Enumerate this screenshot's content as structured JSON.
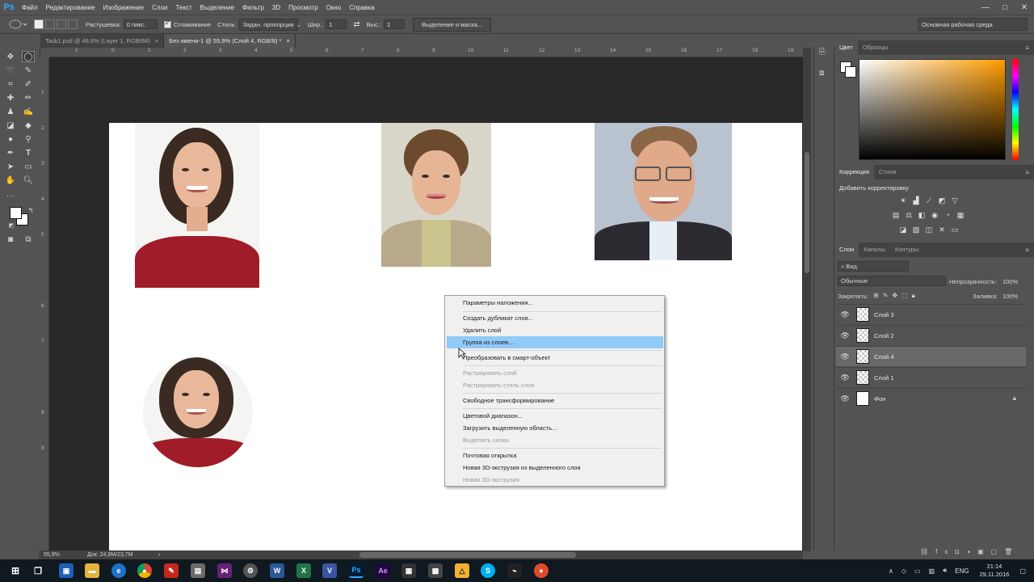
{
  "app": {
    "logo": "Ps"
  },
  "menubar": {
    "items": [
      "Файл",
      "Редактирование",
      "Изображение",
      "Слои",
      "Текст",
      "Выделение",
      "Фильтр",
      "3D",
      "Просмотр",
      "Окно",
      "Справка"
    ],
    "window_controls": [
      "—",
      "□",
      "✕"
    ]
  },
  "options": {
    "feather_label": "Растушевка:",
    "feather_value": "0 пикс.",
    "antialias_label": "Сглаживание",
    "style_label": "Стиль:",
    "style_value": "Задан. пропорции",
    "width_label": "Шир.:",
    "width_value": "1",
    "height_label": "Выс.:",
    "height_value": "1",
    "mask_button": "Выделение и маска...",
    "workspace": "Основная рабочая среда"
  },
  "tabs": [
    {
      "label": "Task1.psd @ 48,8% (Layer 1, RGB/8#)",
      "active": false
    },
    {
      "label": "Без имени-1 @ 55,9% (Слой 4, RGB/8) *",
      "active": true
    }
  ],
  "ruler": {
    "top": [
      "1",
      "0",
      "1",
      "2",
      "3",
      "4",
      "5",
      "6",
      "7",
      "8",
      "9",
      "10",
      "11",
      "12",
      "13",
      "14",
      "15",
      "16",
      "17",
      "18",
      "19"
    ],
    "left": [
      "1",
      "2",
      "3",
      "4",
      "5",
      "6",
      "7",
      "8",
      "9"
    ]
  },
  "statusbar": {
    "zoom": "55,9%",
    "doc": "Док: 24,9M/23,7M"
  },
  "panels": {
    "color_tabs": [
      "Цвет",
      "Образцы"
    ],
    "adjust_tabs": [
      "Коррекция",
      "Стили"
    ],
    "adjust_title": "Добавить корректировку",
    "layers_tabs": [
      "Слои",
      "Каналы",
      "Контуры"
    ],
    "layer_kind": "Вид",
    "blend_mode": "Обычные",
    "opacity_label": "Непрозрачность:",
    "opacity_value": "100%",
    "lock_label": "Закрепить:",
    "fill_label": "Заливка:",
    "fill_value": "100%",
    "menu_glyph": "≡"
  },
  "layers": [
    {
      "name": "Слой 3",
      "selected": false
    },
    {
      "name": "Слой 2",
      "selected": false
    },
    {
      "name": "Слой 4",
      "selected": true
    },
    {
      "name": "Слой 1",
      "selected": false
    },
    {
      "name": "Фон",
      "selected": false
    }
  ],
  "context_menu": [
    {
      "label": "Параметры наложения...",
      "disabled": false
    },
    {
      "label": "Создать дубликат слоя...",
      "disabled": false
    },
    {
      "label": "Удалить слой",
      "disabled": false
    },
    {
      "label": "Группа из слоев...",
      "disabled": false,
      "highlighted": true
    },
    {
      "label": "Преобразовать в смарт-объект",
      "disabled": false
    },
    {
      "label": "Растрировать слой",
      "disabled": true
    },
    {
      "label": "Растрировать стиль слоя",
      "disabled": true
    },
    {
      "label": "Свободное трансформирование",
      "disabled": false
    },
    {
      "label": "Цветовой диапазон...",
      "disabled": false
    },
    {
      "label": "Загрузить выделенную область...",
      "disabled": false
    },
    {
      "label": "Выделить снова",
      "disabled": true
    },
    {
      "label": "Почтовая открытка",
      "disabled": false
    },
    {
      "label": "Новая 3D-экструзия из выделенного слоя",
      "disabled": false
    },
    {
      "label": "Новая 3D-экструзия",
      "disabled": true
    }
  ],
  "taskbar": {
    "apps": [
      "start-icon",
      "task-view-icon",
      "save-icon",
      "folder-icon",
      "ie-icon",
      "chrome-icon",
      "pdf-icon",
      "app-icon",
      "vs-icon",
      "vs-code-icon",
      "word-icon",
      "excel-icon",
      "visio-icon",
      "photoshop-icon",
      "after-effects-icon",
      "media-icon",
      "calc-icon",
      "gdrive-icon",
      "skype-icon",
      "inkscape-icon",
      "record-icon"
    ],
    "lang": "ENG",
    "time": "21:14",
    "date": "29.11.2016"
  },
  "colors": {
    "accent_ps": "#31a8ff",
    "highlight": "#91c9f7",
    "canvas": "#ffffff",
    "shirt_red": "#a01c28"
  }
}
